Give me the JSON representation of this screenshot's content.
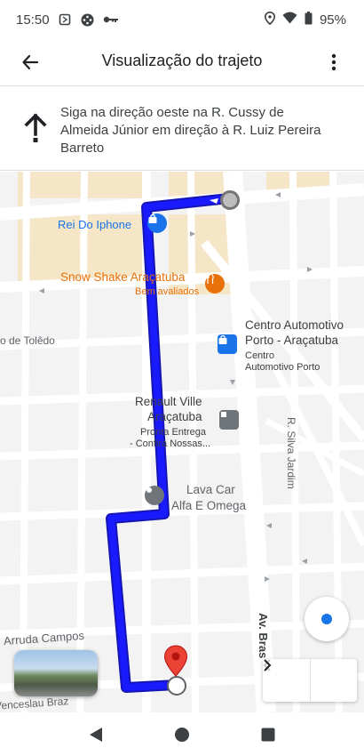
{
  "status_bar": {
    "time": "15:50",
    "battery": "95%",
    "left_icons": [
      "screenshot-icon",
      "game-controller-icon",
      "key-icon"
    ],
    "right_icons": [
      "location-icon",
      "wifi-icon",
      "battery-icon"
    ]
  },
  "app_bar": {
    "title": "Visualização do trajeto",
    "back_icon": "arrow-back-icon",
    "more_icon": "more-vert-icon"
  },
  "instruction": {
    "icon": "arrow-up-icon",
    "text": "Siga na direção oeste na R. Cussy de Almeida Júnior em direção à R. Luiz Pereira Barreto"
  },
  "map": {
    "places": {
      "rei_do_iphone": "Rei Do Iphone",
      "snow_shake": "Snow Shake Araçatuba",
      "snow_shake_sub": "Bem avaliados",
      "centro_line1": "Centro Automotivo",
      "centro_line2": "Porto - Araçatuba",
      "centro_sub1": "Centro",
      "centro_sub2": "Automotivo Porto",
      "renault_line1": "Renault Ville",
      "renault_line2": "Araçatuba",
      "renault_sub1": "Pronta Entrega",
      "renault_sub2": "- Confira Nossas...",
      "lava_line1": "Lava Car",
      "lava_line2": "Alfa E Omega"
    },
    "streets": {
      "toledo": "o de Tolêdo",
      "silva_jardim": "R. Silva Jardim",
      "av_bras": "Av. Bras",
      "arruda_campos": "Arruda Campos",
      "venceslau_braz": "Venceslau Braz"
    },
    "colors": {
      "route": "#1a1aff",
      "route_border": "#1515b5",
      "destination_pin": "#ea4335",
      "park": "#f5e6c8"
    }
  },
  "nav_bar": {
    "back_icon": "nav-back-icon",
    "home_icon": "nav-home-icon",
    "recents_icon": "nav-recents-icon"
  }
}
